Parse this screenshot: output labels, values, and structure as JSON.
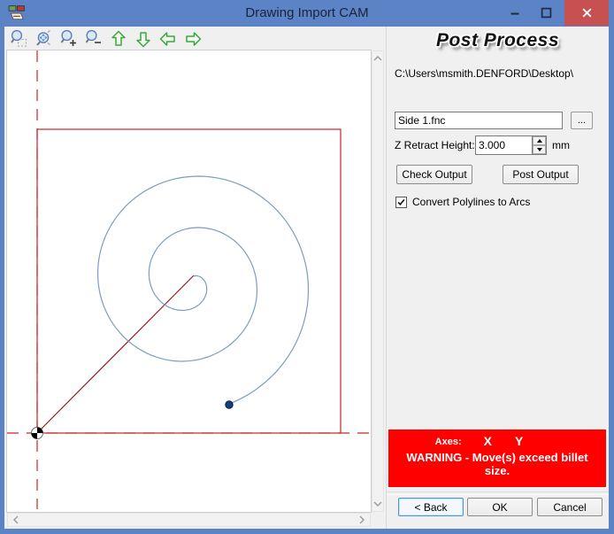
{
  "window": {
    "title": "Drawing Import CAM"
  },
  "toolbar": {
    "icons": [
      "zoom-window",
      "zoom-dynamic",
      "zoom-in",
      "zoom-out",
      "pan-up",
      "pan-down",
      "pan-left",
      "pan-right"
    ]
  },
  "post_panel": {
    "title": "Post Process",
    "output_path": "C:\\Users\\msmith.DENFORD\\Desktop\\",
    "filename_value": "Side 1.fnc",
    "browse_label": "...",
    "z_retract_label": "Z Retract Height:",
    "z_retract_value": "3.000",
    "z_retract_unit": "mm",
    "check_output_label": "Check Output",
    "post_output_label": "Post Output",
    "convert_polylines_label": "Convert Polylines to Arcs",
    "convert_polylines_checked": true,
    "warning": {
      "axes_label": "Axes:",
      "axis_x": "X",
      "axis_y": "Y",
      "message": "WARNING - Move(s) exceed billet size."
    },
    "back_label": "< Back",
    "ok_label": "OK",
    "cancel_label": "Cancel"
  },
  "colors": {
    "titlebar": "#5b83c6",
    "close_button": "#c75050",
    "warning_bg": "#fe0000",
    "billet_outline": "#cc2424",
    "axis_dashed": "#cc2424",
    "lead_line": "#8e1f1f",
    "toolpath": "#7d9cc4",
    "endpoint": "#123f7d",
    "pan_arrow": "#3fa63f"
  }
}
